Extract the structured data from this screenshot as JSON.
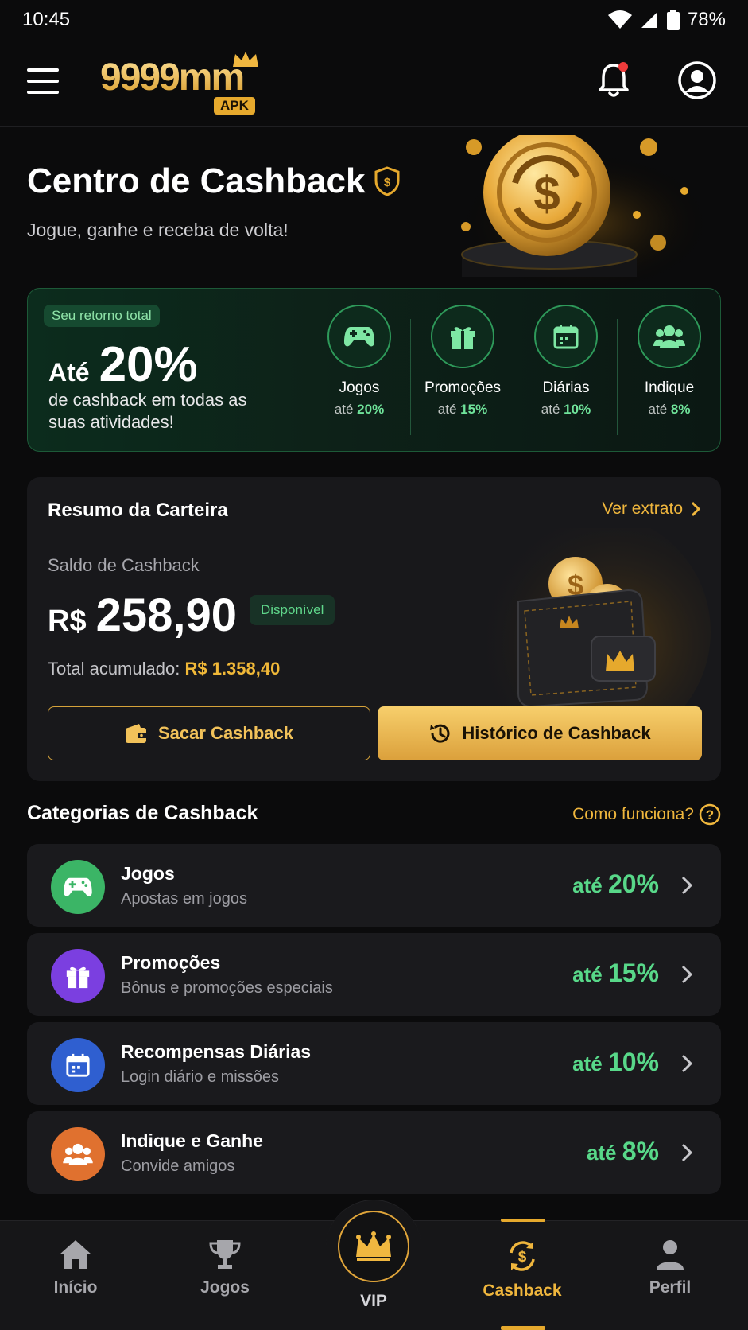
{
  "status_bar": {
    "time": "10:45",
    "battery": "78%"
  },
  "app_bar": {
    "logo_text": "9999mm",
    "logo_badge": "APK"
  },
  "hero": {
    "title": "Centro de Cashback",
    "subtitle": "Jogue, ganhe e receba de volta!"
  },
  "promo": {
    "chip": "Seu retorno total",
    "ate": "Até",
    "percent": "20%",
    "description": "de cashback em todas as suas atividades!",
    "stats": [
      {
        "label": "Jogos",
        "prefix": "até",
        "value": "20%",
        "icon": "gamepad-icon"
      },
      {
        "label": "Promoções",
        "prefix": "até",
        "value": "15%",
        "icon": "gift-icon"
      },
      {
        "label": "Diárias",
        "prefix": "até",
        "value": "10%",
        "icon": "calendar-icon"
      },
      {
        "label": "Indique",
        "prefix": "até",
        "value": "8%",
        "icon": "users-icon"
      }
    ]
  },
  "wallet": {
    "title": "Resumo da Carteira",
    "link": "Ver extrato",
    "saldo_label": "Saldo de Cashback",
    "currency": "R$",
    "balance": "258,90",
    "badge": "Disponível",
    "total_label": "Total acumulado:",
    "total_value": "R$ 1.358,40",
    "btn_withdraw": "Sacar Cashback",
    "btn_history": "Histórico de Cashback"
  },
  "categories": {
    "title": "Categorias de Cashback",
    "help": "Como funciona?",
    "items": [
      {
        "title": "Jogos",
        "subtitle": "Apostas em jogos",
        "prefix": "até",
        "value": "20%",
        "color": "#3bb566",
        "icon": "gamepad-icon"
      },
      {
        "title": "Promoções",
        "subtitle": "Bônus e promoções especiais",
        "prefix": "até",
        "value": "15%",
        "color": "#7b3fe0",
        "icon": "gift-icon"
      },
      {
        "title": "Recompensas Diárias",
        "subtitle": "Login diário e missões",
        "prefix": "até",
        "value": "10%",
        "color": "#2f5fd0",
        "icon": "calendar-icon"
      },
      {
        "title": "Indique e Ganhe",
        "subtitle": "Convide amigos",
        "prefix": "até",
        "value": "8%",
        "color": "#e0712f",
        "icon": "users-icon"
      }
    ]
  },
  "bottom_nav": {
    "items": [
      {
        "label": "Início",
        "icon": "home-icon"
      },
      {
        "label": "Jogos",
        "icon": "trophy-icon"
      },
      {
        "label": "VIP",
        "icon": "crown-icon"
      },
      {
        "label": "Cashback",
        "icon": "cashback-icon",
        "active": true
      },
      {
        "label": "Perfil",
        "icon": "person-icon"
      }
    ]
  }
}
